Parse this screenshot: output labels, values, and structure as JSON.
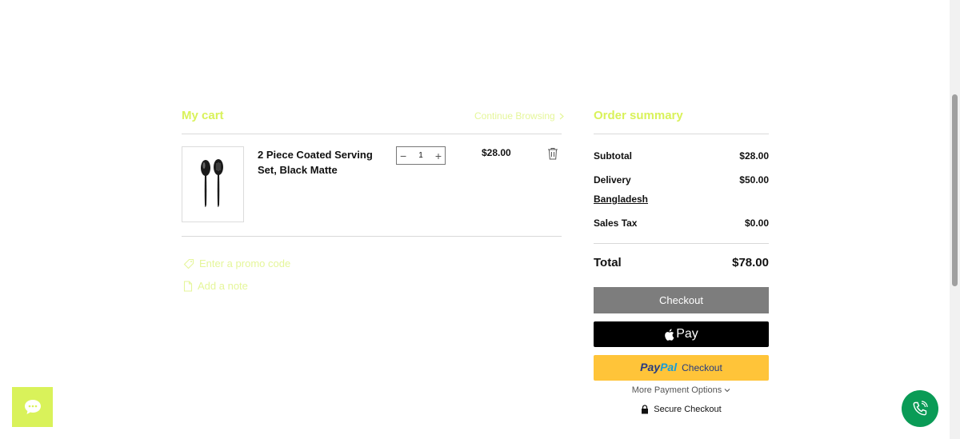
{
  "cart": {
    "title": "My cart",
    "continue_label": "Continue Browsing",
    "items": [
      {
        "name": "2 Piece Coated Serving Set, Black Matte",
        "quantity": "1",
        "price": "$28.00"
      }
    ],
    "promo_label": "Enter a promo code",
    "note_label": "Add a note"
  },
  "summary": {
    "title": "Order summary",
    "subtotal_label": "Subtotal",
    "subtotal_value": "$28.00",
    "delivery_label": "Delivery",
    "delivery_value": "$50.00",
    "delivery_destination": "Bangladesh",
    "tax_label": "Sales Tax",
    "tax_value": "$0.00",
    "total_label": "Total",
    "total_value": "$78.00",
    "checkout_label": "Checkout",
    "applepay_label": "Pay",
    "paypal_part1": "Pay",
    "paypal_part2": "Pal",
    "paypal_checkout": "Checkout",
    "more_options_label": "More Payment Options",
    "secure_label": "Secure Checkout"
  },
  "colors": {
    "accent": "#d9f25a",
    "checkout_button": "#7d7d7d",
    "paypal_yellow": "#ffc439",
    "phone_green": "#0a9b56"
  },
  "icons": [
    "chevron-right-icon",
    "minus-icon",
    "plus-icon",
    "trash-icon",
    "tag-icon",
    "note-icon",
    "apple-icon",
    "chevron-down-icon",
    "lock-icon",
    "chat-icon",
    "phone-icon"
  ]
}
